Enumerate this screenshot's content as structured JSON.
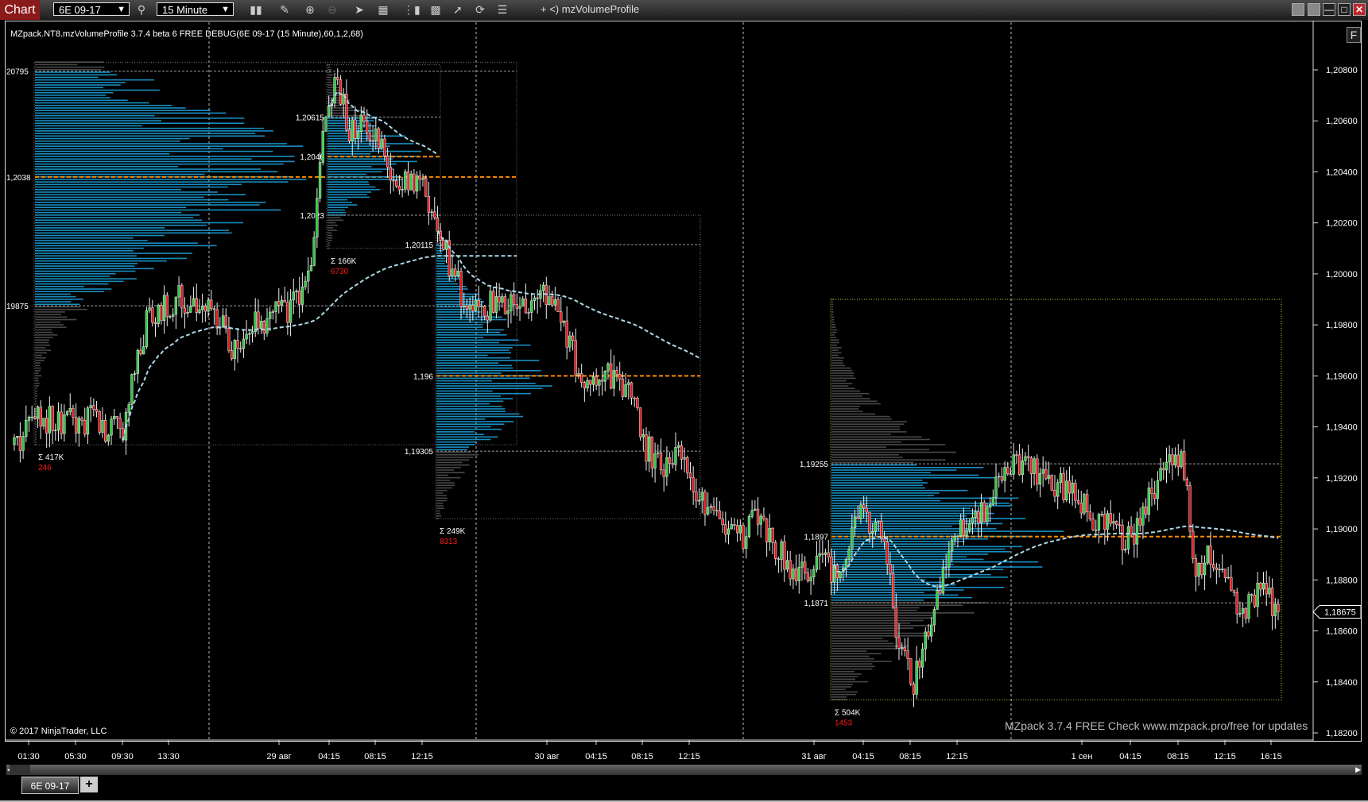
{
  "toolbar": {
    "chart_label": "Chart",
    "instrument": "6E 09-17",
    "interval": "15 Minute",
    "indicator_prefix": "+ <)",
    "indicator_name": "mzVolumeProfile",
    "icons": [
      "search-icon",
      "bar-style-icon",
      "pencil-icon",
      "zoom-in-icon",
      "zoom-out-icon",
      "pointer-icon",
      "data-box-icon",
      "strategies-icon",
      "layout-icon",
      "drawing-tools-icon",
      "refresh-icon",
      "properties-icon"
    ]
  },
  "window": {
    "buttons": [
      "restore-icon",
      "restore-icon",
      "minimize-icon",
      "maximize-icon",
      "close-icon"
    ],
    "close_color": "#c0262c"
  },
  "chart": {
    "indicator_title": "MZpack.NT8.mzVolumeProfile 3.7.4 beta 6 FREE DEBUG(6E 09-17 (15 Minute),60,1,2,68)",
    "copyright": "© 2017 NinjaTrader, LLC",
    "promo": "MZpack 3.7.4 FREE  Check www.mzpack.pro/free for updates",
    "f_button": "F",
    "price_axis": [
      "1,20800",
      "1,20600",
      "1,20400",
      "1,20200",
      "1,20000",
      "1,19800",
      "1,19600",
      "1,19400",
      "1,19200",
      "1,19000",
      "1,18800",
      "1,18600",
      "1,18400",
      "1,18200"
    ],
    "price_axis_values": [
      1.208,
      1.206,
      1.204,
      1.202,
      1.2,
      1.198,
      1.196,
      1.194,
      1.192,
      1.19,
      1.188,
      1.186,
      1.184,
      1.182
    ],
    "last_price": "1,18675",
    "last_price_value": 1.18675,
    "time_axis": [
      "01:30",
      "05:30",
      "09:30",
      "13:30",
      "29 авг",
      "04:15",
      "08:15",
      "12:15",
      "30 авг",
      "04:15",
      "08:15",
      "12:15",
      "31 авг",
      "04:15",
      "08:15",
      "12:15",
      "1 сен",
      "04:15",
      "08:15",
      "12:15",
      "16:15"
    ],
    "colors": {
      "up": "#2ecc40",
      "down": "#e0191b",
      "poc": "#ff8c00",
      "value_area": "#1b9fd6",
      "outside_va": "#5a5a5a",
      "vwap": "#add8e6",
      "last_box": "#ffffff",
      "volume_total": "#ffffff",
      "delta": "#ff1a1a",
      "profile4_border": "#c8c832"
    },
    "price_path": [
      [
        0,
        1.1933
      ],
      [
        7,
        1.1943
      ],
      [
        25,
        1.1943
      ],
      [
        37,
        1.1937
      ],
      [
        40,
        1.1955
      ],
      [
        46,
        1.1985
      ],
      [
        55,
        1.199
      ],
      [
        70,
        1.1982
      ],
      [
        74,
        1.1972
      ],
      [
        84,
        1.1982
      ],
      [
        96,
        1.1988
      ],
      [
        101,
        1.2
      ],
      [
        104,
        1.204
      ],
      [
        107,
        1.207
      ],
      [
        110,
        1.2075
      ],
      [
        114,
        1.2058
      ],
      [
        123,
        1.2058
      ],
      [
        126,
        1.2045
      ],
      [
        132,
        1.2035
      ],
      [
        138,
        1.204
      ],
      [
        144,
        1.202
      ],
      [
        148,
        1.2003
      ],
      [
        155,
        1.1985
      ],
      [
        164,
        1.1988
      ],
      [
        173,
        1.1988
      ],
      [
        182,
        1.1994
      ],
      [
        186,
        1.1985
      ],
      [
        192,
        1.196
      ],
      [
        203,
        1.196
      ],
      [
        210,
        1.1955
      ],
      [
        215,
        1.1932
      ],
      [
        221,
        1.1925
      ],
      [
        227,
        1.1928
      ],
      [
        233,
        1.191
      ],
      [
        248,
        1.1898
      ],
      [
        254,
        1.1905
      ],
      [
        263,
        1.1885
      ],
      [
        281,
        1.1885
      ],
      [
        287,
        1.1905
      ],
      [
        296,
        1.19
      ],
      [
        300,
        1.1862
      ],
      [
        306,
        1.184
      ],
      [
        313,
        1.187
      ],
      [
        319,
        1.1895
      ],
      [
        331,
        1.191
      ],
      [
        340,
        1.1928
      ],
      [
        355,
        1.1918
      ],
      [
        367,
        1.1905
      ],
      [
        379,
        1.1895
      ],
      [
        385,
        1.191
      ],
      [
        391,
        1.1925
      ],
      [
        397,
        1.193
      ],
      [
        402,
        1.1885
      ],
      [
        409,
        1.189
      ],
      [
        416,
        1.1868
      ],
      [
        424,
        1.1875
      ],
      [
        430,
        1.18675
      ]
    ],
    "profiles": [
      {
        "high": 1.2083,
        "low": 1.1933,
        "poc": 1.2038,
        "va_high_label": "20795",
        "va_high": 1.20795,
        "poc_label": "1,2038",
        "va_low_label": "19875",
        "va_low": 1.19875,
        "total": "Σ 417K",
        "delta": "246"
      },
      {
        "high": 1.2082,
        "low": 1.201,
        "poc": 1.2046,
        "va_high_label": "1,20615",
        "va_high": 1.20615,
        "poc_label": "1,2046",
        "va_low_label": "1,2023",
        "va_low": 1.2023,
        "total": "Σ 166K",
        "delta": "6730"
      },
      {
        "high": 1.2023,
        "low": 1.1904,
        "poc": 1.196,
        "va_high_label": "1,20115",
        "va_high": 1.20115,
        "poc_label": "1,196",
        "va_low_label": "1,19305",
        "va_low": 1.19305,
        "total": "Σ 249K",
        "delta": "8313"
      },
      {
        "high": 1.199,
        "low": 1.1833,
        "poc": 1.1897,
        "va_high_label": "1,19255",
        "va_high": 1.19255,
        "poc_label": "1,1897",
        "va_low_label": "1,1871",
        "va_low": 1.1871,
        "total": "Σ 504K",
        "delta": "1453"
      }
    ]
  },
  "tabs": {
    "active": "6E 09-17",
    "add": "+"
  }
}
